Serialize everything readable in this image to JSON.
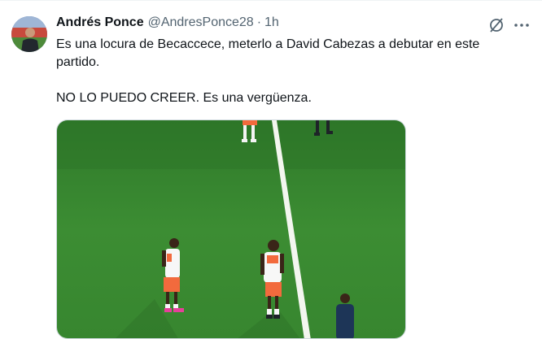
{
  "tweet": {
    "author_name": "Andrés Ponce",
    "author_handle": "@AndresPonce28",
    "separator": "·",
    "timestamp": "1h",
    "text_line1": "Es una locura de Becaccece, meterlo a David Cabezas a debutar en este partido.",
    "text_line2": "NO LO PUEDO CREER. Es una vergüenza.",
    "media": {
      "type": "photo",
      "description_icon": "photo-icon"
    }
  },
  "actions": {
    "grok_icon": "grok-icon",
    "more_icon": "more-options-icon"
  },
  "colors": {
    "text_primary": "#0f1419",
    "text_secondary": "#536471",
    "pitch_green": "#3f8f33",
    "kit_orange": "#f26a3d"
  }
}
